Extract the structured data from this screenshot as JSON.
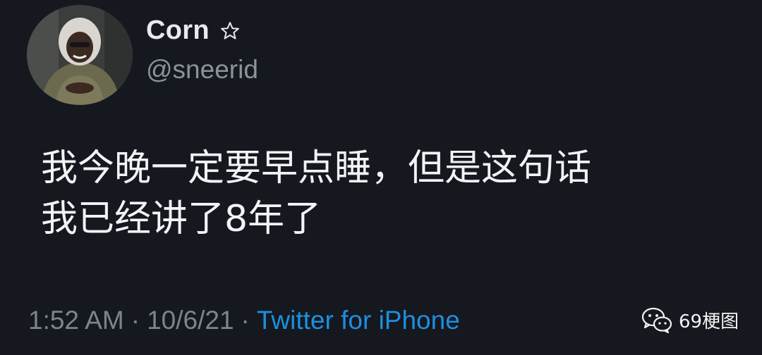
{
  "tweet": {
    "avatar_icon": "user-avatar",
    "display_name": "Corn",
    "badge_icon": "star-outline-icon",
    "handle": "@sneerid",
    "text_lines": [
      "我今晚一定要早点睡，但是这句话",
      "我已经讲了8年了"
    ],
    "time": "1:52 AM",
    "separator": "·",
    "date": "10/6/21",
    "source": "Twitter for iPhone"
  },
  "watermark": {
    "icon": "wechat-icon",
    "text": "69梗图"
  },
  "colors": {
    "background": "#15181f",
    "text_primary": "#f2f3f5",
    "text_secondary": "#7d848d",
    "link": "#1d8fe0"
  }
}
